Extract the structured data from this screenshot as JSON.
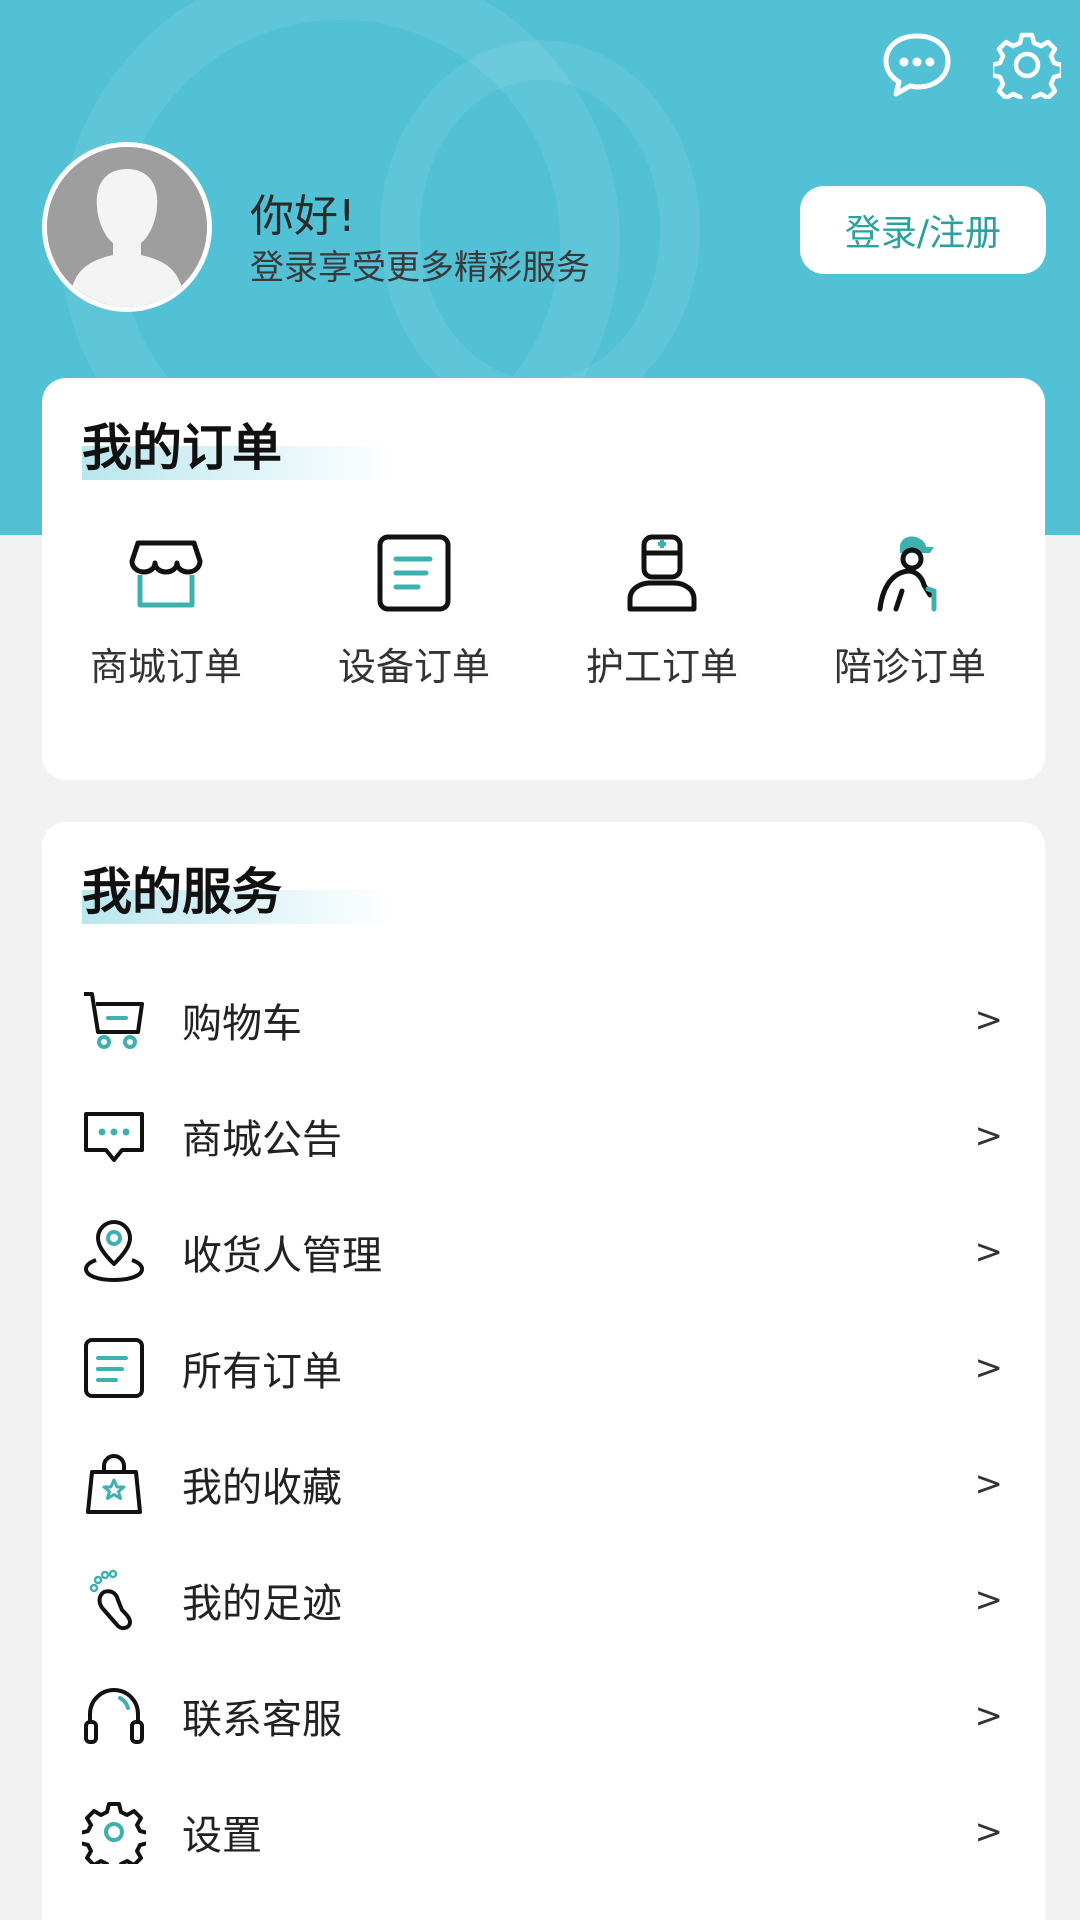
{
  "header": {
    "greeting": "你好!",
    "subtitle": "登录享受更多精彩服务",
    "login_label": "登录/注册"
  },
  "icons": {
    "message": "chat-bubble-icon",
    "settings": "gear-icon",
    "avatar": "default-avatar"
  },
  "orders": {
    "title": "我的订单",
    "items": [
      {
        "label": "商城订单",
        "icon": "shop-icon"
      },
      {
        "label": "设备订单",
        "icon": "document-icon"
      },
      {
        "label": "护工订单",
        "icon": "nurse-icon"
      },
      {
        "label": "陪诊订单",
        "icon": "companion-icon"
      }
    ]
  },
  "services": {
    "title": "我的服务",
    "arrow": ">",
    "items": [
      {
        "label": "购物车",
        "icon": "cart-icon"
      },
      {
        "label": "商城公告",
        "icon": "announcement-icon"
      },
      {
        "label": "收货人管理",
        "icon": "location-icon"
      },
      {
        "label": "所有订单",
        "icon": "order-list-icon"
      },
      {
        "label": "我的收藏",
        "icon": "favorite-bag-icon"
      },
      {
        "label": "我的足迹",
        "icon": "footprint-icon"
      },
      {
        "label": "联系客服",
        "icon": "headset-icon"
      },
      {
        "label": "设置",
        "icon": "gear-icon"
      }
    ]
  },
  "colors": {
    "header_bg": "#52c1d5",
    "accent": "#2aa0a0",
    "teal_icon": "#3fb0b0"
  }
}
